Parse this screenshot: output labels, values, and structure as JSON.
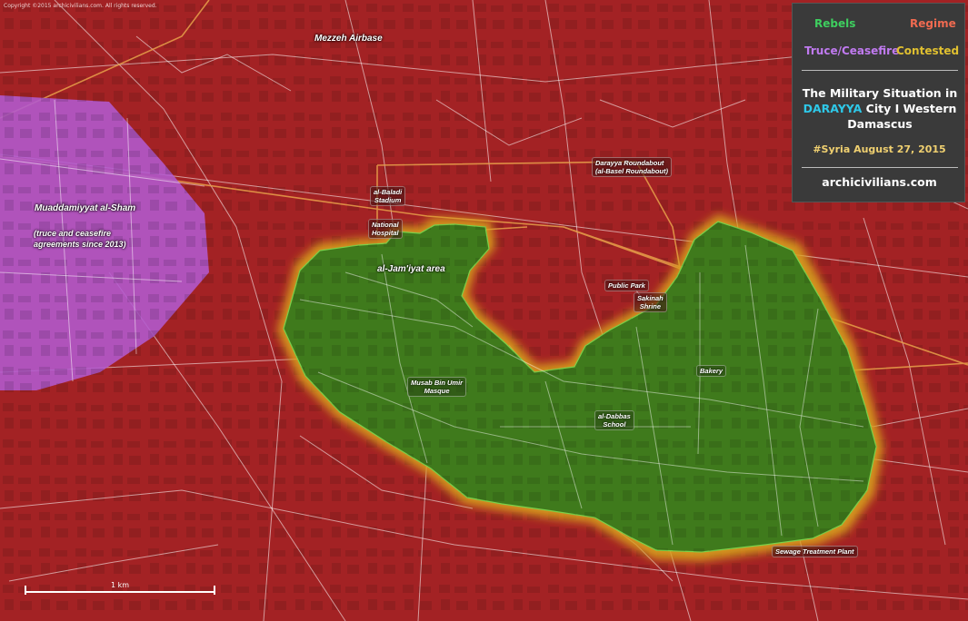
{
  "copyright": "Copyright ©2015 archicivilians.com. All rights reserved.",
  "legend": {
    "rebels": "Rebels",
    "regime": "Regime",
    "truce": "Truce/Ceasefire",
    "contested": "Contested",
    "title_line1": "The Military Situation in",
    "title_highlight": "DARAYYA",
    "title_line2_rest": " City I Western",
    "title_line3": "Damascus",
    "date": "#Syria  August 27, 2015",
    "website": "archicivilians.com"
  },
  "places": {
    "airbase": "Mezzeh Airbase",
    "muadamiyat": "Muaddamiyyat al-Sham",
    "truce_note_1": "(truce and ceasefire",
    "truce_note_2": "agreements since 2013)",
    "jamiyat": "al-Jam'iyat area",
    "stadium_1": "al-Baladi",
    "stadium_2": "Stadium",
    "hospital_1": "National",
    "hospital_2": "Hospital",
    "roundabout_1": "Darayya Roundabout",
    "roundabout_2": "(al-Basel Roundabout)",
    "park": "Public Park",
    "shrine_1": "Sakinah",
    "shrine_2": "Shrine",
    "bakery": "Bakery",
    "mosque_1": "Musab Bin Umir",
    "mosque_2": "Masque",
    "school_1": "al-Dabbas",
    "school_2": "School",
    "sewage": "Sewage Treatment Plant"
  },
  "scale": {
    "label": "1 km"
  },
  "colors": {
    "regime": "#a32224",
    "rebels": "#3f7a1c",
    "truce": "#b25ad0",
    "contested": "#d9a21c",
    "rebels_text": "#3ecf5f",
    "regime_text": "#f06a50",
    "truce_text": "#c07af0",
    "contested_text": "#e0c030"
  }
}
